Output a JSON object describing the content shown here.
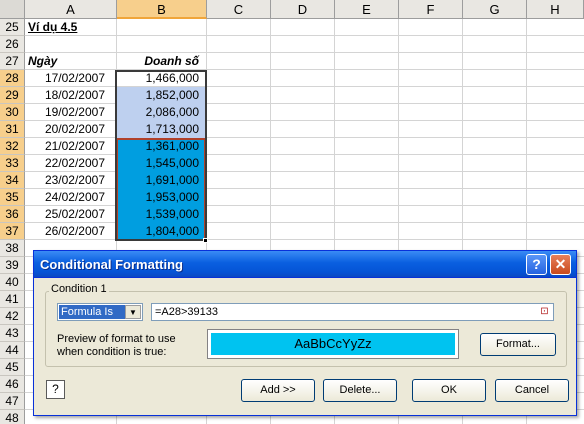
{
  "sheet": {
    "columns": [
      "A",
      "B",
      "C",
      "D",
      "E",
      "F",
      "G",
      "H"
    ],
    "rows": [
      "25",
      "26",
      "27",
      "28",
      "29",
      "30",
      "31",
      "32",
      "33",
      "34",
      "35",
      "36",
      "37",
      "38",
      "39",
      "40",
      "41",
      "42",
      "43",
      "44",
      "45",
      "46",
      "47",
      "48"
    ],
    "cells": {
      "a25": "Ví dụ 4.5",
      "a27": "Ngày",
      "b27": "Doanh số",
      "dates": [
        "17/02/2007",
        "18/02/2007",
        "19/02/2007",
        "20/02/2007",
        "21/02/2007",
        "22/02/2007",
        "23/02/2007",
        "24/02/2007",
        "25/02/2007",
        "26/02/2007"
      ],
      "sales": [
        "1,466,000",
        "1,852,000",
        "2,086,000",
        "1,713,000",
        "1,361,000",
        "1,545,000",
        "1,691,000",
        "1,953,000",
        "1,539,000",
        "1,804,000"
      ]
    },
    "colors": {
      "selected_fill": "#bed0ef",
      "formatted_fill": "#009ee0",
      "first_cell_fill": "#ffffff"
    }
  },
  "dialog": {
    "title": "Conditional Formatting",
    "help_glyph": "?",
    "close_glyph": "✕",
    "condition_label": "Condition 1",
    "condition_type": "Formula Is",
    "formula": "=A28>39133",
    "collapse_glyph": "⊡",
    "preview_label_1": "Preview of format to use",
    "preview_label_2": "when condition is true:",
    "preview_text": "AaBbCcYyZz",
    "preview_color": "#00c3f0",
    "format_button": "Format...",
    "add_button": "Add >>",
    "delete_button": "Delete...",
    "ok_button": "OK",
    "cancel_button": "Cancel",
    "help_icon_glyph": "?"
  }
}
